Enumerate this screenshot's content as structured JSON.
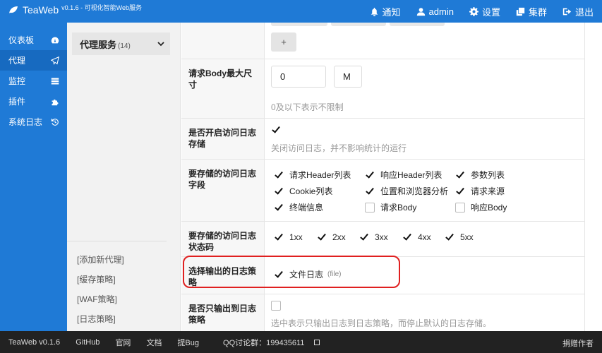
{
  "app": {
    "title": "TeaWeb",
    "version_tag": "v0.1.6 - 可视化智能Web服务"
  },
  "topnav": {
    "notify": "通知",
    "user": "admin",
    "settings": "设置",
    "cluster": "集群",
    "logout": "退出"
  },
  "sidebar": {
    "items": [
      {
        "label": "仪表板",
        "icon": "dashboard-icon"
      },
      {
        "label": "代理",
        "icon": "paper-plane-icon"
      },
      {
        "label": "监控",
        "icon": "server-icon"
      },
      {
        "label": "插件",
        "icon": "puzzle-icon"
      },
      {
        "label": "系统日志",
        "icon": "history-icon"
      }
    ],
    "active": "代理"
  },
  "submenu": {
    "title": "代理服务",
    "count": "(14)",
    "links": [
      "[添加新代理]",
      "[缓存策略]",
      "[WAF策略]",
      "[日志策略]"
    ]
  },
  "form": {
    "add_button": "+",
    "body_size": {
      "label": "请求Body最大尺寸",
      "value": "0",
      "unit": "M",
      "hint": "0及以下表示不限制"
    },
    "access_log": {
      "label": "是否开启访问日志存储",
      "checked": true,
      "hint": "关闭访问日志，并不影响统计的运行"
    },
    "log_fields": {
      "label": "要存储的访问日志字段",
      "options": [
        {
          "label": "请求Header列表",
          "checked": true
        },
        {
          "label": "响应Header列表",
          "checked": true
        },
        {
          "label": "参数列表",
          "checked": true
        },
        {
          "label": "Cookie列表",
          "checked": true
        },
        {
          "label": "位置和浏览器分析",
          "checked": true
        },
        {
          "label": "请求来源",
          "checked": true
        },
        {
          "label": "终端信息",
          "checked": true
        },
        {
          "label": "请求Body",
          "checked": false
        },
        {
          "label": "响应Body",
          "checked": false
        }
      ]
    },
    "status_codes": {
      "label": "要存储的访问日志状态码",
      "options": [
        "1xx",
        "2xx",
        "3xx",
        "4xx",
        "5xx"
      ]
    },
    "output_policy": {
      "label": "选择输出的日志策略",
      "option": "文件日志",
      "tag": "(file)",
      "checked": true
    },
    "only_output": {
      "label": "是否只输出到日志策略",
      "checked": false,
      "hint": "选中表示只输出日志到日志策略，而停止默认的日志存储。"
    }
  },
  "footer": {
    "version": "TeaWeb v0.1.6",
    "links": [
      "GitHub",
      "官网",
      "文档",
      "提Bug"
    ],
    "qq": "QQ讨论群：199435611",
    "donate": "捐赠作者"
  },
  "colors": {
    "primary": "#1f7ad6",
    "highlight": "#e02020",
    "footer": "#222222"
  }
}
